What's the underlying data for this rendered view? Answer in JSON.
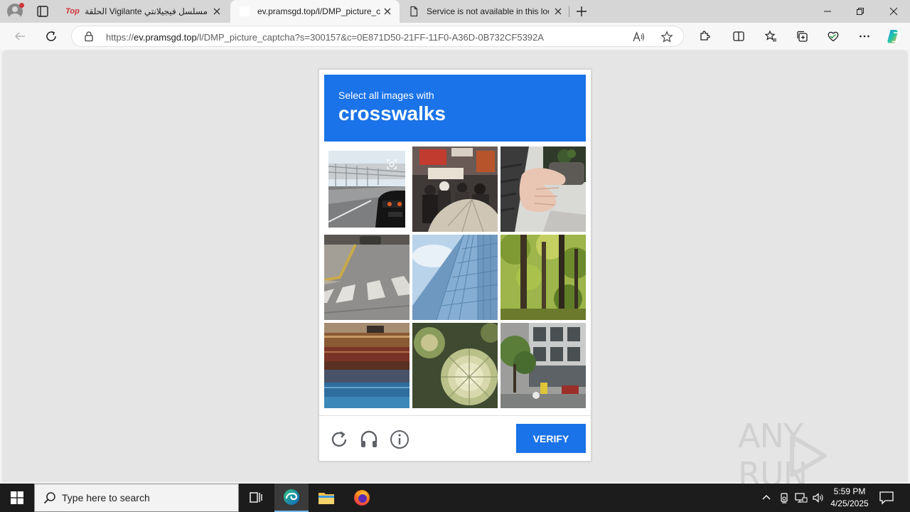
{
  "tabs": [
    {
      "title": "مسلسل فيجيلانتي Vigilante الحلقة",
      "favicon": "Top"
    },
    {
      "title": "ev.pramsgd.top/l/DMP_picture_c"
    },
    {
      "title": "Service is not available in this loc"
    }
  ],
  "address": {
    "prefix": "https://",
    "host": "ev.pramsgd.top",
    "path": "/l/DMP_picture_captcha?s=300157&c=0E871D50-21FF-11F0-A36D-0B732CF5392A"
  },
  "captcha": {
    "instruction": "Select all images with",
    "target": "crosswalks",
    "verify_label": "VERIFY",
    "tiles": [
      "car-on-bridge",
      "crowd-with-umbrella",
      "hands-with-flowers",
      "crosswalk-street",
      "glass-skyscraper",
      "forest-trees",
      "stacked-books",
      "succulent-plant",
      "city-street-building"
    ]
  },
  "watermark": "ANY RUN",
  "taskbar": {
    "search_placeholder": "Type here to search",
    "time": "5:59 PM",
    "date": "4/25/2025"
  },
  "colors": {
    "accent": "#1a73e8",
    "taskbar": "#1c1c1c"
  }
}
